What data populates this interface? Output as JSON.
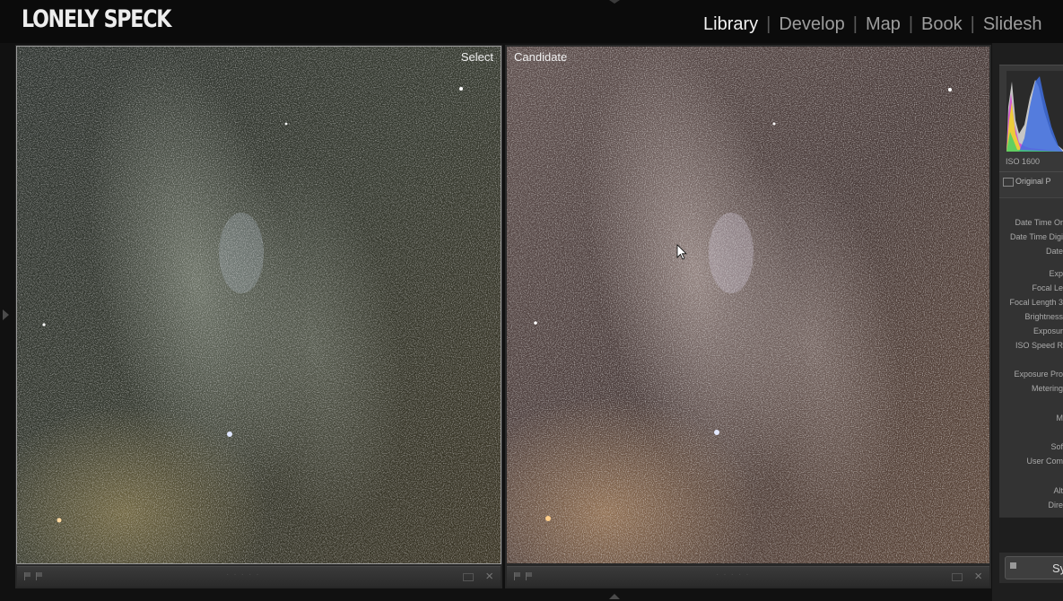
{
  "watermark": "LONELY SPECK",
  "modules": [
    {
      "label": "Library",
      "active": true
    },
    {
      "label": "Develop",
      "active": false
    },
    {
      "label": "Map",
      "active": false
    },
    {
      "label": "Book",
      "active": false
    },
    {
      "label": "Slidesh",
      "active": false
    }
  ],
  "compare": {
    "select_label": "Select",
    "candidate_label": "Candidate"
  },
  "histogram": {
    "iso": "ISO 1600",
    "original_label": "Original P"
  },
  "metadata_labels": [
    "Date Time Or",
    "Date Time Digi",
    "Date",
    "Exp",
    "Focal Le",
    "Focal Length 3",
    "Brightness",
    "Exposur",
    "ISO Speed R",
    "Exposure Pro",
    "Metering",
    "M",
    "Sof",
    "User Com",
    "Alt",
    "Dire"
  ],
  "sync": {
    "label": "Syn"
  },
  "colors": {
    "background": "#111111",
    "active_module": "#f2f2f2",
    "inactive_module": "#9d9d9d",
    "panel": "#333333"
  }
}
